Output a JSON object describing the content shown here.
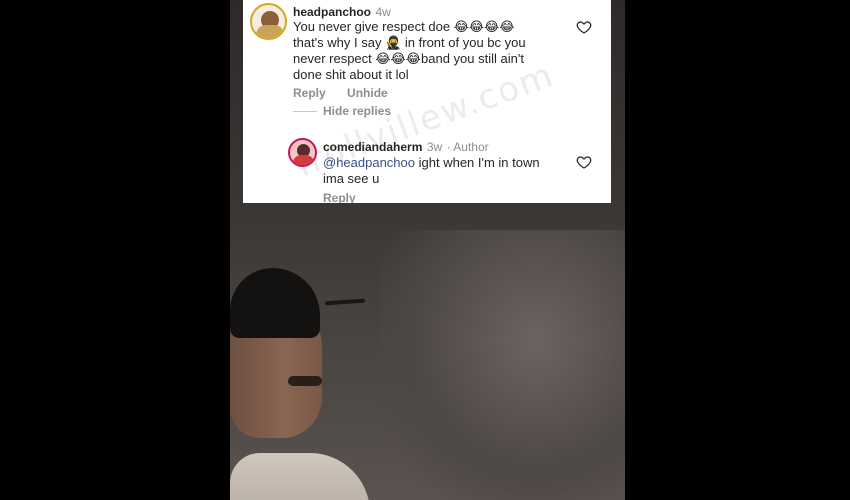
{
  "comments": [
    {
      "username": "headpanchoo",
      "age": "4w",
      "text_line1": "You never give respect doe",
      "text_line2a": "that's why I say",
      "text_line2b": "in front of you bc you",
      "text_line3a": "never respect",
      "text_line3b": "band you still ain't",
      "text_line4": "done shit about it lol",
      "reply_label": "Reply",
      "unhide_label": "Unhide",
      "hide_replies_label": "Hide replies"
    },
    {
      "username": "comediandaherm",
      "age": "3w",
      "author_badge": "· Author",
      "mention": "@headpanchoo",
      "text_line1": "ight when I'm in town",
      "text_line2": "ima see u",
      "reply_label": "Reply"
    }
  ],
  "watermark": "Trollvillew.com",
  "emoji": {
    "laugh": "😂",
    "ninja": "🥷"
  },
  "colors": {
    "mention": "#385185",
    "username": "#262626",
    "meta": "#8e8e8e",
    "avatar_ring_1": "#d9a520",
    "avatar_ring_2": "#c2185b"
  },
  "icons": [
    "heart-icon",
    "heart-icon"
  ]
}
